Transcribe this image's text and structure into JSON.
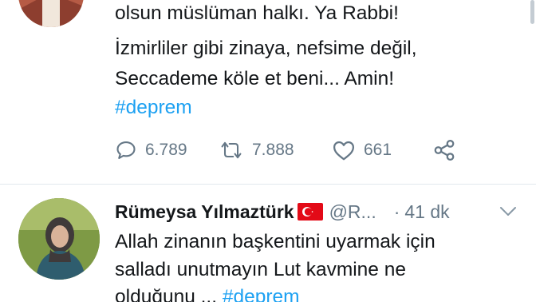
{
  "tweet1": {
    "lines": [
      "olsun müslüman halkı. Ya Rabbi!",
      "İzmirliler gibi zinaya, nefsime değil,",
      "Seccademe köle et beni... Amin!"
    ],
    "hashtag": "#deprem",
    "reply_count": "6.789",
    "retweet_count": "7.888",
    "like_count": "661",
    "icons": [
      "reply-icon",
      "retweet-icon",
      "like-icon",
      "share-icon"
    ]
  },
  "tweet2": {
    "name": "Rümeysa Yılmaztürk",
    "handle": "@R...",
    "dot": "·",
    "time": "41 dk",
    "lines": [
      "Allah zinanın başkentini uyarmak için",
      "salladı unutmayın Lut kavmine ne"
    ],
    "last_line_text": "olduğunu ...",
    "last_line_hashtag": "#deprem",
    "icons": [
      "turkey-flag-icon",
      "chevron-down-icon"
    ]
  },
  "colors": {
    "text": "#14171a",
    "muted": "#657786",
    "link": "#1da1f2",
    "divider": "#e1e8ed"
  }
}
